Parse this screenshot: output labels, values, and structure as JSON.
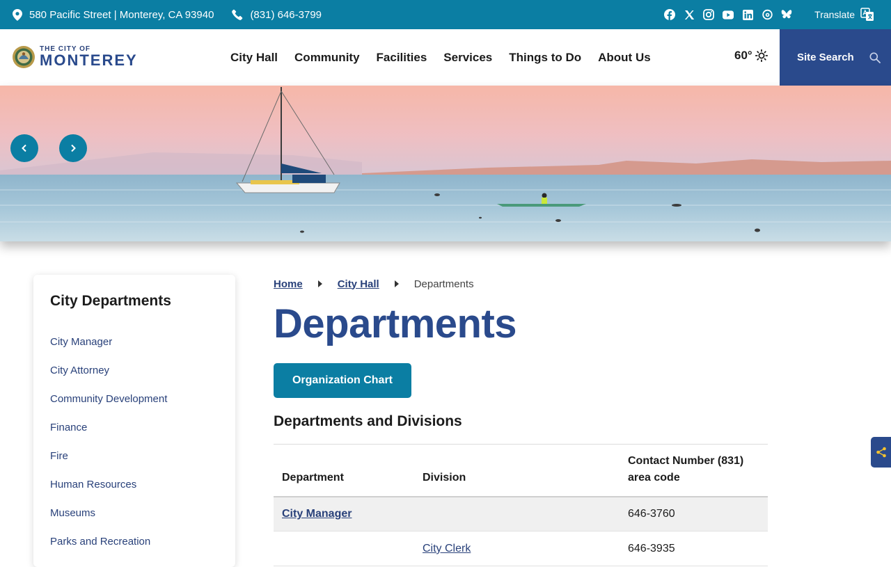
{
  "topbar": {
    "address": "580 Pacific Street | Monterey, CA 93940",
    "phone": "(831) 646-3799",
    "social_icons": [
      "facebook-icon",
      "x-icon",
      "instagram-icon",
      "youtube-icon",
      "linkedin-icon",
      "threads-icon",
      "bluesky-icon"
    ],
    "translate_label": "Translate"
  },
  "header": {
    "logo_small": "THE CITY OF",
    "logo_big": "MONTEREY",
    "nav": [
      "City Hall",
      "Community",
      "Facilities",
      "Services",
      "Things to Do",
      "About Us"
    ],
    "weather": "60°",
    "search_label": "Site Search"
  },
  "sidebar": {
    "title": "City Departments",
    "items": [
      "City Manager",
      "City Attorney",
      "Community Development",
      "Finance",
      "Fire",
      "Human Resources",
      "Museums",
      "Parks and Recreation"
    ]
  },
  "main": {
    "breadcrumb": {
      "home": "Home",
      "parent": "City Hall",
      "current": "Departments"
    },
    "title": "Departments",
    "org_chart_label": "Organization Chart",
    "section_title": "Departments and Divisions",
    "table": {
      "headers": [
        "Department",
        "Division",
        "Contact Number (831) area code"
      ],
      "rows": [
        {
          "department": "City Manager",
          "division": "",
          "contact": "646-3760"
        },
        {
          "department": "",
          "division": "City Clerk",
          "contact": "646-3935"
        }
      ]
    }
  },
  "colors": {
    "topbar": "#0b7ea3",
    "brand_blue": "#2a4a8c",
    "link": "#29417a"
  }
}
